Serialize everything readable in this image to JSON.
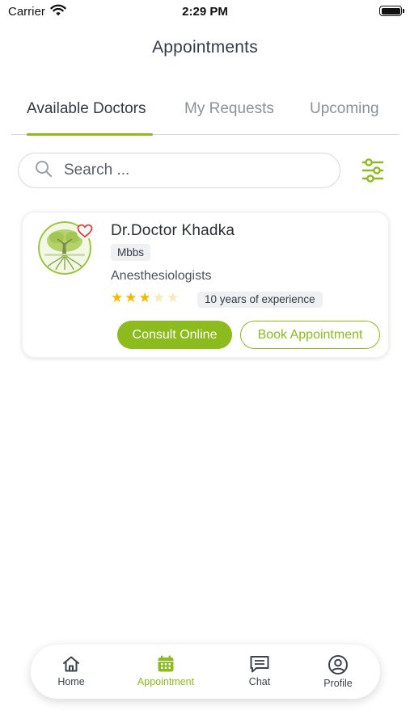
{
  "status_bar": {
    "carrier": "Carrier",
    "time": "2:29 PM"
  },
  "header": {
    "title": "Appointments"
  },
  "tabs": [
    {
      "label": "Available Doctors",
      "active": true
    },
    {
      "label": "My Requests",
      "active": false
    },
    {
      "label": "Upcoming",
      "active": false
    }
  ],
  "search": {
    "placeholder": "Search ...",
    "value": ""
  },
  "icons": {
    "search": "search-icon",
    "filter": "sliders-icon",
    "favorite": "heart-outline-icon",
    "home": "home-icon",
    "appointment": "calendar-icon",
    "chat": "chat-bubble-icon",
    "profile": "user-circle-icon"
  },
  "doctors": [
    {
      "name": "Dr.Doctor Khadka",
      "degree": "Mbbs",
      "specialty": "Anesthesiologists",
      "rating": 3,
      "rating_max": 5,
      "experience": "10 years of experience",
      "consult_label": "Consult Online",
      "book_label": "Book Appointment"
    }
  ],
  "bottom_nav": [
    {
      "label": "Home",
      "active": false
    },
    {
      "label": "Appointment",
      "active": true
    },
    {
      "label": "Chat",
      "active": false
    },
    {
      "label": "Profile",
      "active": false
    }
  ],
  "colors": {
    "accent": "#8bbb1c",
    "text_primary": "#333b46",
    "text_muted": "#8b9198",
    "star_filled": "#f5b800",
    "star_empty": "#f7e9b5",
    "favorite": "#e53935"
  }
}
